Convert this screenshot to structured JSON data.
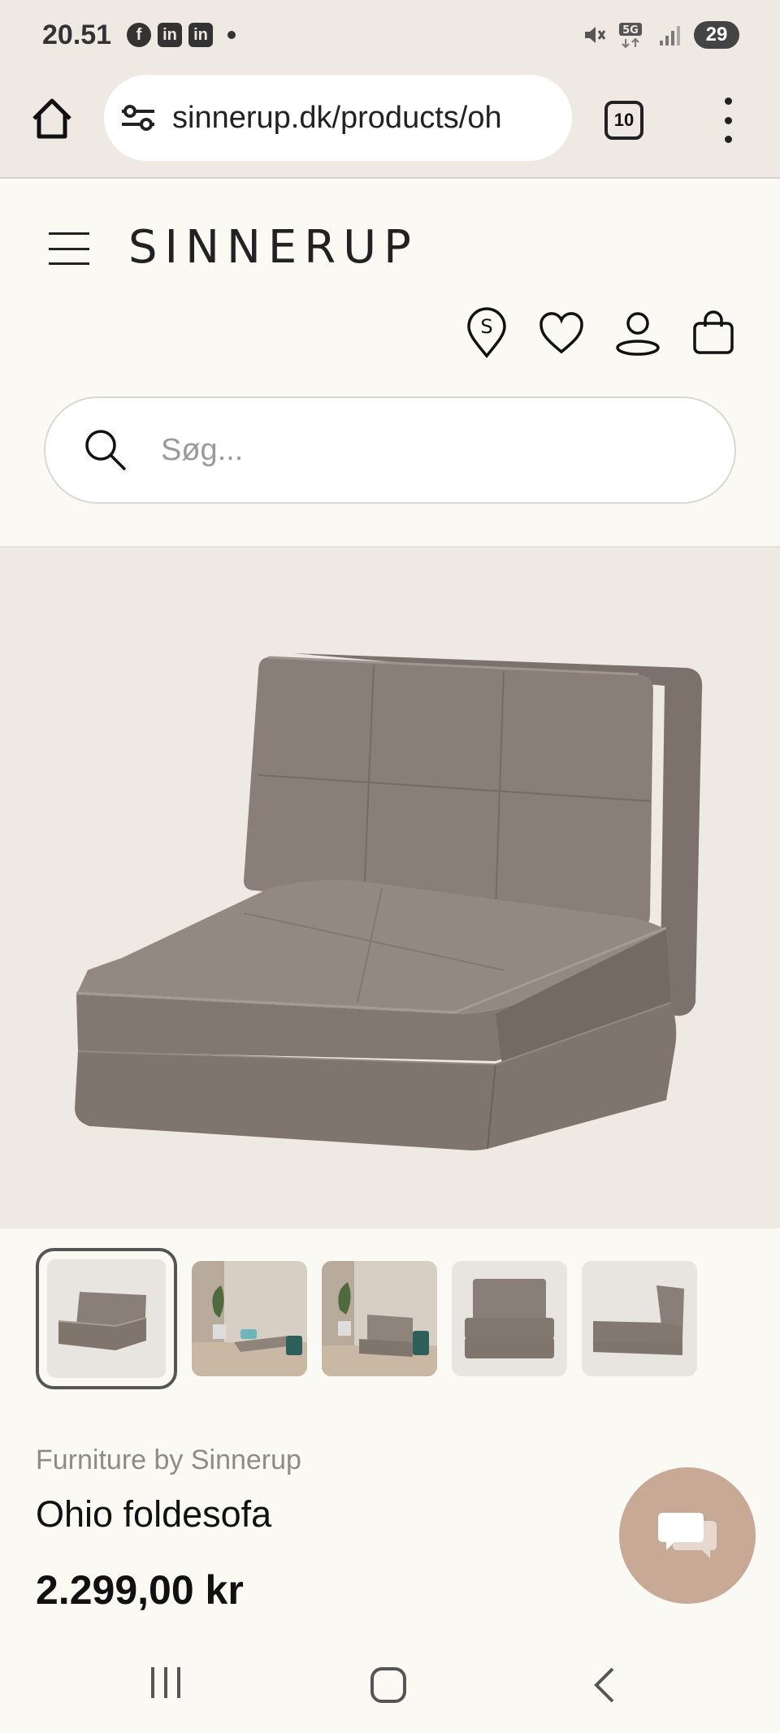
{
  "status_bar": {
    "time": "20.51",
    "apps": [
      "f",
      "in",
      "in"
    ],
    "network": "5G",
    "battery": "29"
  },
  "browser": {
    "url": "sinnerup.dk/products/oh",
    "tab_count": "10"
  },
  "header": {
    "logo": "SINNERUP",
    "icons": [
      "store-locator-icon",
      "heart-icon",
      "user-icon",
      "bag-icon"
    ],
    "search_placeholder": "Søg..."
  },
  "product": {
    "thumbnails_count": 5,
    "active_thumbnail": 1,
    "brand": "Furniture by Sinnerup",
    "name": "Ohio foldesofa",
    "price": "2.299,00 kr"
  },
  "colors": {
    "background": "#fbf9f4",
    "chrome": "#efe9e4",
    "chat_button": "#c8a995",
    "sofa": "#8a7f78"
  }
}
